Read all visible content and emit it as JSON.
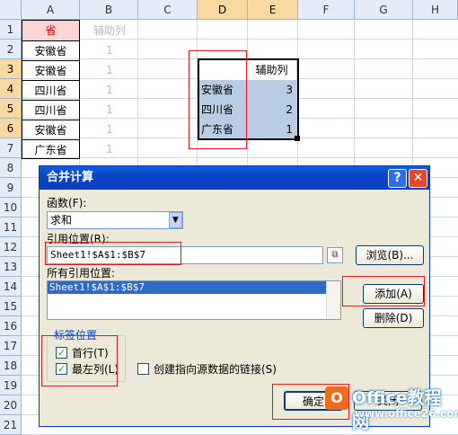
{
  "columns": [
    "A",
    "B",
    "C",
    "D",
    "E",
    "F",
    "G",
    "H"
  ],
  "selected_columns": [
    "D",
    "E"
  ],
  "rows": [
    "1",
    "2",
    "3",
    "4",
    "5",
    "6",
    "7",
    "8",
    "9",
    "10",
    "11",
    "12",
    "13",
    "14",
    "15",
    "16",
    "17",
    "18",
    "19",
    "20",
    "21"
  ],
  "selected_rows": [
    "3",
    "4",
    "5",
    "6"
  ],
  "colA": {
    "header": "省",
    "values": [
      "安徽省",
      "安徽省",
      "四川省",
      "四川省",
      "安徽省",
      "广东省"
    ]
  },
  "colB": {
    "header": "辅助列",
    "values": [
      "1",
      "1",
      "1",
      "1",
      "1",
      "1"
    ]
  },
  "result_table": {
    "header": "辅助列",
    "rows": [
      {
        "name": "安徽省",
        "value": "3"
      },
      {
        "name": "四川省",
        "value": "2"
      },
      {
        "name": "广东省",
        "value": "1"
      }
    ]
  },
  "dialog": {
    "title": "合并计算",
    "help_btn": "?",
    "close_btn": "✕",
    "function_label": "函数(F):",
    "function_value": "求和",
    "reference_label": "引用位置(R):",
    "reference_value": "Sheet1!$A$1:$B$7",
    "browse_btn": "浏览(B)...",
    "all_refs_label": "所有引用位置:",
    "all_refs": [
      "Sheet1!$A$1:$B$7"
    ],
    "add_btn": "添加(A)",
    "delete_btn": "删除(D)",
    "label_position": "标签位置",
    "first_row": "首行(T)",
    "left_column": "最左列(L)",
    "link_source": "创建指向源数据的链接(S)",
    "ok_btn": "确定",
    "cancel_btn": "关闭"
  },
  "watermark": {
    "brand": "Office教程网",
    "url": "www.office26.com"
  },
  "colors": {
    "accent": "#e8141b",
    "selection": "#b8cce4",
    "header_sel": "#f9d99f",
    "titlebar": "#0b46c7"
  }
}
